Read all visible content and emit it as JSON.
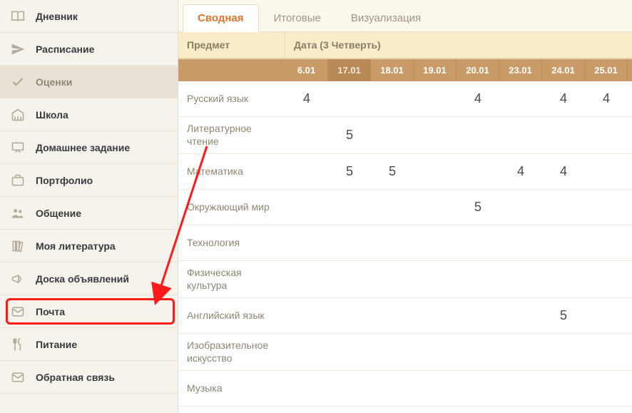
{
  "sidebar": {
    "items": [
      {
        "label": "Дневник",
        "icon": "book-open-icon"
      },
      {
        "label": "Расписание",
        "icon": "paper-plane-icon"
      },
      {
        "label": "Оценки",
        "icon": "check-icon",
        "active": true
      },
      {
        "label": "Школа",
        "icon": "building-icon"
      },
      {
        "label": "Домашнее задание",
        "icon": "board-icon"
      },
      {
        "label": "Портфолио",
        "icon": "briefcase-icon"
      },
      {
        "label": "Общение",
        "icon": "people-icon"
      },
      {
        "label": "Моя литература",
        "icon": "books-icon"
      },
      {
        "label": "Доска объявлений",
        "icon": "megaphone-icon"
      },
      {
        "label": "Почта",
        "icon": "mail-icon",
        "highlight": true
      },
      {
        "label": "Питание",
        "icon": "cutlery-icon"
      },
      {
        "label": "Обратная связь",
        "icon": "envelope-icon"
      }
    ]
  },
  "tabs": [
    {
      "label": "Сводная",
      "active": true
    },
    {
      "label": "Итоговые"
    },
    {
      "label": "Визуализация"
    }
  ],
  "table": {
    "subject_header": "Предмет",
    "date_header": "Дата (3 Четверть)",
    "dates": [
      "6.01",
      "17.01",
      "18.01",
      "19.01",
      "20.01",
      "23.01",
      "24.01",
      "25.01"
    ],
    "selected_date_index": 1,
    "rows": [
      {
        "subject": "Русский язык",
        "grades": [
          "4",
          "",
          "",
          "",
          "4",
          "",
          "4",
          "4"
        ]
      },
      {
        "subject": "Литературное чтение",
        "grades": [
          "",
          "5",
          "",
          "",
          "",
          "",
          "",
          ""
        ]
      },
      {
        "subject": "Математика",
        "grades": [
          "",
          "5",
          "5",
          "",
          "",
          "4",
          "4",
          ""
        ]
      },
      {
        "subject": "Окружающий мир",
        "grades": [
          "",
          "",
          "",
          "",
          "5",
          "",
          "",
          ""
        ]
      },
      {
        "subject": "Технология",
        "grades": [
          "",
          "",
          "",
          "",
          "",
          "",
          "",
          ""
        ]
      },
      {
        "subject": "Физическая культура",
        "grades": [
          "",
          "",
          "",
          "",
          "",
          "",
          "",
          ""
        ]
      },
      {
        "subject": "Английский язык",
        "grades": [
          "",
          "",
          "",
          "",
          "",
          "",
          "5",
          ""
        ]
      },
      {
        "subject": "Изобразительное искусство",
        "grades": [
          "",
          "",
          "",
          "",
          "",
          "",
          "",
          ""
        ]
      },
      {
        "subject": "Музыка",
        "grades": [
          "",
          "",
          "",
          "",
          "",
          "",
          "",
          ""
        ]
      }
    ]
  },
  "annotation": {
    "arrow": {
      "from_subject_index": 2,
      "to_sidebar_index": 9
    }
  }
}
